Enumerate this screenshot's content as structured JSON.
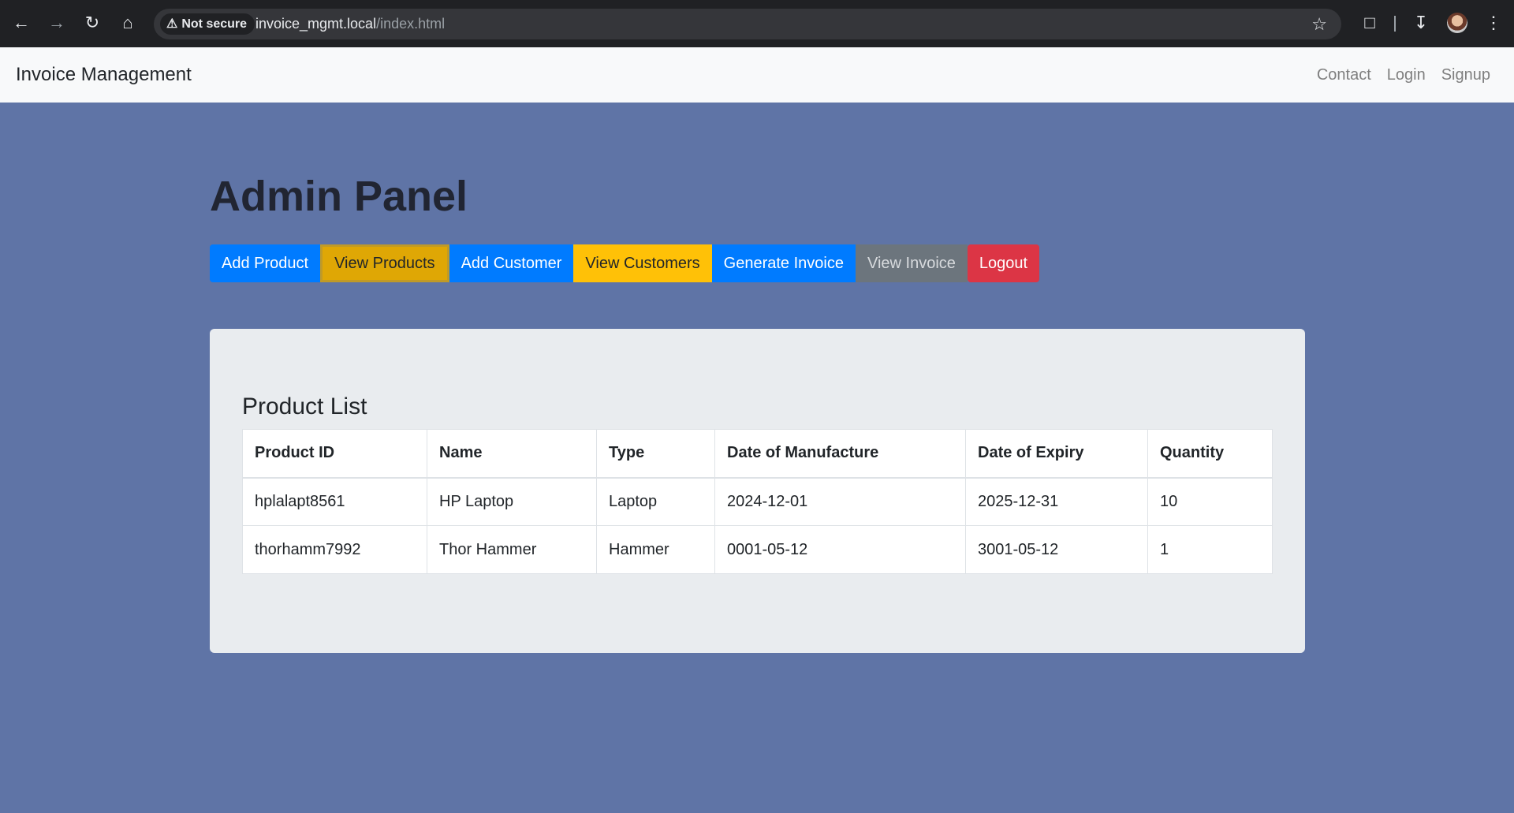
{
  "browser": {
    "security_label": "Not secure",
    "url_host": "invoice_mgmt.local",
    "url_path": "/index.html"
  },
  "navbar": {
    "brand": "Invoice Management",
    "links": [
      "Contact",
      "Login",
      "Signup"
    ]
  },
  "page": {
    "title": "Admin Panel",
    "buttons": {
      "add_product": "Add Product",
      "view_products": "View Products",
      "add_customer": "Add Customer",
      "view_customers": "View Customers",
      "generate_invoice": "Generate Invoice",
      "view_invoice": "View Invoice",
      "logout": "Logout"
    }
  },
  "products": {
    "heading": "Product List",
    "columns": [
      "Product ID",
      "Name",
      "Type",
      "Date of Manufacture",
      "Date of Expiry",
      "Quantity"
    ],
    "rows": [
      [
        "hplalapt8561",
        "HP Laptop",
        "Laptop",
        "2024-12-01",
        "2025-12-31",
        "10"
      ],
      [
        "thorhamm7992",
        "Thor Hammer",
        "Hammer",
        "0001-05-12",
        "3001-05-12",
        "1"
      ]
    ]
  },
  "colors": {
    "page_bg": "#5f74a6",
    "primary": "#007bff",
    "warning": "#ffc107",
    "secondary": "#6c757d",
    "danger": "#dc3545"
  }
}
